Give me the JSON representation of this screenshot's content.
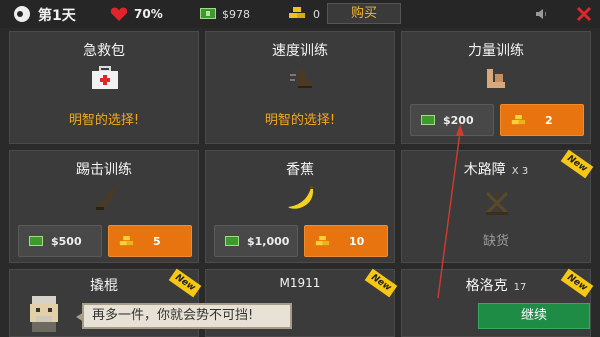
{
  "topbar": {
    "day": "第1天",
    "health": "70%",
    "cash": "$978",
    "gold": "0",
    "buy_label": "购买"
  },
  "cards": [
    {
      "title": "急救包",
      "tagline": "明智的选择!"
    },
    {
      "title": "速度训练",
      "tagline": "明智的选择!"
    },
    {
      "title": "力量训练",
      "cash_price": "$200",
      "gold_price": "2"
    },
    {
      "title": "踢击训练",
      "cash_price": "$500",
      "gold_price": "5"
    },
    {
      "title": "香蕉",
      "cash_price": "$1,000",
      "gold_price": "10"
    },
    {
      "title": "木路障",
      "qty": "X 3",
      "status": "缺货",
      "badge": "New"
    },
    {
      "title": "撬棍",
      "badge": "New"
    },
    {
      "title": "M1911",
      "badge": "New"
    },
    {
      "title": "格洛克",
      "qty": "17",
      "badge": "New"
    }
  ],
  "dialog": {
    "message": "再多一件，你就会势不可挡!",
    "continue_label": "继续"
  },
  "colors": {
    "accent_orange": "#e7740e",
    "tagline": "#f2a81d",
    "continue_green": "#1f8c46",
    "new_badge": "#f6c714"
  }
}
